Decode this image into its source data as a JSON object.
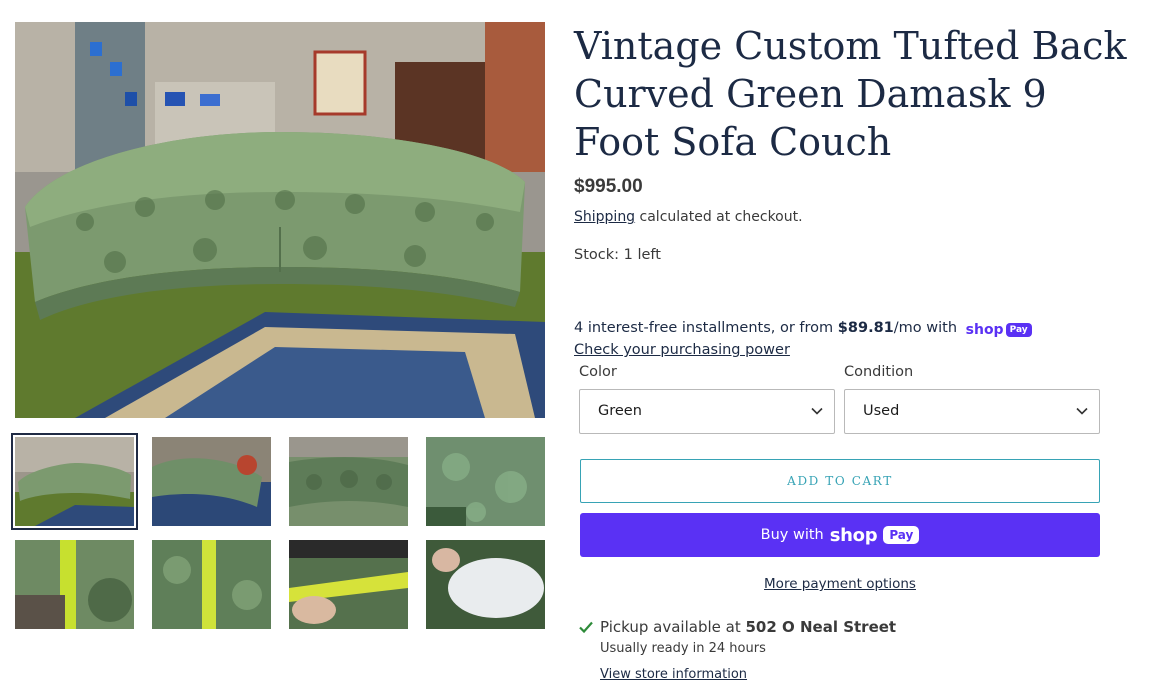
{
  "product": {
    "title": "Vintage Custom Tufted Back Curved Green Damask 9 Foot Sofa Couch",
    "price": "$995.00",
    "shipping_link": "Shipping",
    "shipping_suffix": "calculated at checkout.",
    "stock": "Stock: 1 left"
  },
  "gallery": {
    "main_image": "sofa-main-photo",
    "thumbnails": [
      {
        "name": "sofa-front-view"
      },
      {
        "name": "sofa-side-view"
      },
      {
        "name": "sofa-back-view"
      },
      {
        "name": "fabric-closeup"
      },
      {
        "name": "armrest-measure"
      },
      {
        "name": "fabric-measure"
      },
      {
        "name": "cushion-measure"
      },
      {
        "name": "cushion-interior"
      }
    ],
    "selected_index": 0
  },
  "installments": {
    "prefix": "4 interest-free installments, or from",
    "amount": "$89.81",
    "suffix": "/mo with",
    "shop_word": "shop",
    "pay_word": "Pay",
    "link": "Check your purchasing power"
  },
  "options": {
    "color_label": "Color",
    "color_value": "Green",
    "condition_label": "Condition",
    "condition_value": "Used"
  },
  "buttons": {
    "add_to_cart": "ADD TO CART",
    "buy_with": "Buy with",
    "shop_word": "shop",
    "pay_word": "Pay",
    "more_payment": "More payment options"
  },
  "pickup": {
    "prefix": "Pickup available at",
    "location": "502 O Neal Street",
    "ready": "Usually ready in 24 hours",
    "store_link": "View store information"
  },
  "colors": {
    "title": "#1c2a44",
    "accent_teal": "#37a3b5",
    "shop_pay": "#5a31f4",
    "check_green": "#2e8b3a"
  }
}
